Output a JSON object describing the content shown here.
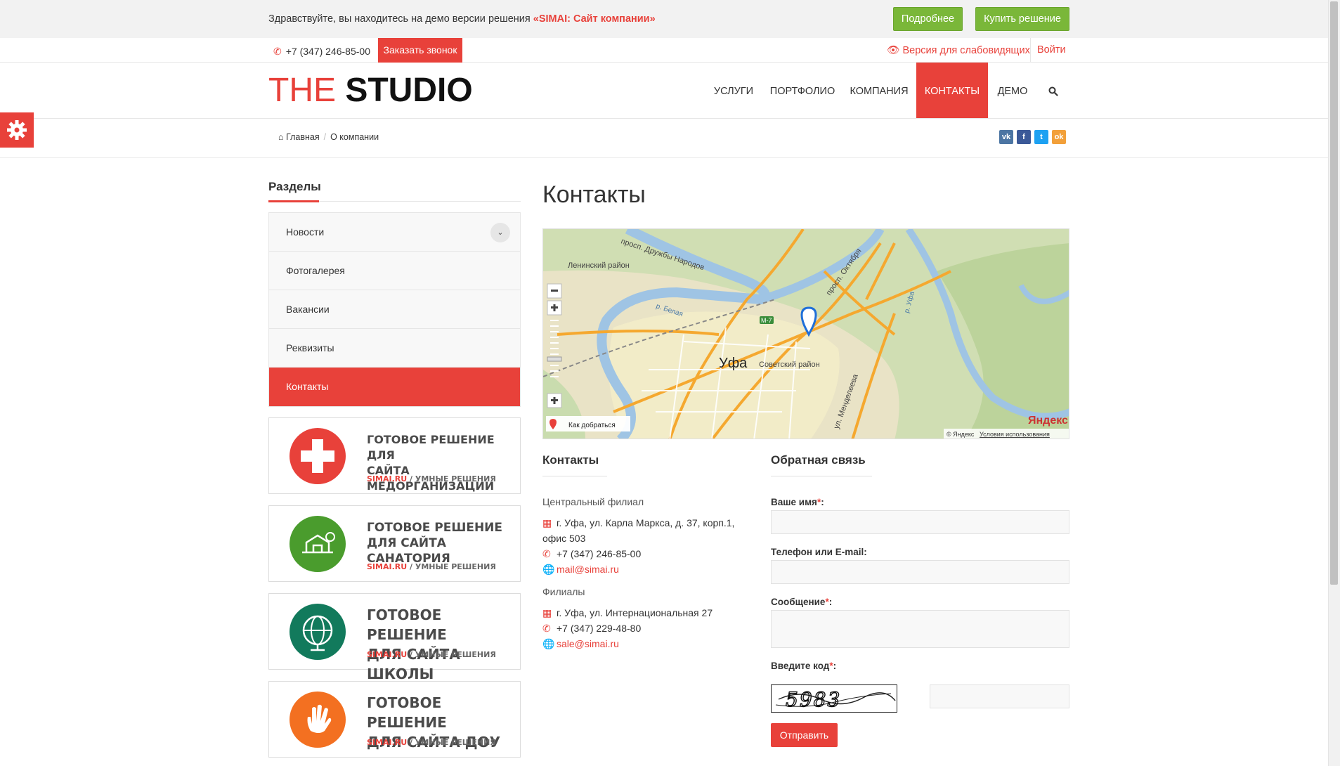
{
  "topbar": {
    "text": "Здравствуйте, вы находитесь на демо версии решения",
    "highlight": "«SIMAI: Сайт компании»",
    "more_label": "Подробнее",
    "buy_label": "Купить решение"
  },
  "contactbar": {
    "phone": "+7 (347) 246-85-00",
    "call_label": "Заказать звонок",
    "visually_impaired": "Версия для слабовидящих",
    "login": "Войти"
  },
  "logo": {
    "part1": "THE",
    "part2": "STUDIO"
  },
  "nav": [
    {
      "label": "УСЛУГИ"
    },
    {
      "label": "ПОРТФОЛИО"
    },
    {
      "label": "КОМПАНИЯ"
    },
    {
      "label": "КОНТАКТЫ"
    },
    {
      "label": "ДЕМО"
    }
  ],
  "breadcrumb": {
    "home": "Главная",
    "current": "О компании"
  },
  "sidebar": {
    "title": "Разделы",
    "items": [
      {
        "label": "Новости"
      },
      {
        "label": "Фотогалерея"
      },
      {
        "label": "Вакансии"
      },
      {
        "label": "Реквизиты"
      },
      {
        "label": "Контакты"
      }
    ]
  },
  "banners": [
    {
      "line1": "ГОТОВОЕ РЕШЕНИЕ ДЛЯ",
      "line2": "САЙТА МЕДОРГАНИЗАЦИИ",
      "brand": "SIMAI.RU",
      "tag": "/ УМНЫЕ РЕШЕНИЯ",
      "color": "#e8413a"
    },
    {
      "line1": "ГОТОВОЕ РЕШЕНИЕ",
      "line2": "ДЛЯ САЙТА САНАТОРИЯ",
      "brand": "SIMAI.RU",
      "tag": "/ УМНЫЕ РЕШЕНИЯ",
      "color": "#4a9c2d"
    },
    {
      "line1": "ГОТОВОЕ РЕШЕНИЕ",
      "line2": "ДЛЯ САЙТА ШКОЛЫ",
      "brand": "SIMAI.RU",
      "tag": "/ УМНЫЕ РЕШЕНИЯ",
      "color": "#127a5c"
    },
    {
      "line1": "ГОТОВОЕ РЕШЕНИЕ",
      "line2": "ДЛЯ САЙТА ДОУ",
      "brand": "SIMAI.RU",
      "tag": "/ УМНЫЕ РЕШЕНИЯ",
      "color": "#f37021"
    }
  ],
  "main": {
    "title": "Контакты",
    "map": {
      "city": "Уфа",
      "labels": {
        "leninsky": "Ленинский район",
        "sovetsky": "Советский район",
        "druzhby": "просп. Дружбы Народов",
        "oktyabrya": "просп. Октября",
        "belaya": "р. Белая",
        "ufa_river": "р. Уфа",
        "mendeleeva": "ул. Менделеева",
        "m7": "М-7"
      },
      "route": "Как добраться",
      "brand": "Яндекс",
      "copyright": "© Яндекс",
      "terms": "Условия использования"
    }
  },
  "contacts": {
    "title": "Контакты",
    "central_title": "Центральный филиал",
    "central_address_1": "г. Уфа, ул. Карла Маркса, д. 37, корп.1,",
    "central_address_2": "офис 503",
    "central_phone": "+7 (347) 246-85-00",
    "central_email": "mail@simai.ru",
    "branches_title": "Филиалы",
    "branch_address": "г. Уфа, ул. Интернациональная 27",
    "branch_phone": "+7 (347) 229-48-80",
    "branch_email": "sale@simai.ru"
  },
  "feedback": {
    "title": "Обратная связь",
    "name_label": "Ваше имя",
    "contact_label": "Телефон или E-mail:",
    "message_label": "Сообщение",
    "code_label": "Введите код",
    "required_mark": "*",
    "captcha_text": "5983",
    "submit_label": "Отправить"
  },
  "colors": {
    "accent": "#e8413a",
    "green": "#7ab739"
  }
}
